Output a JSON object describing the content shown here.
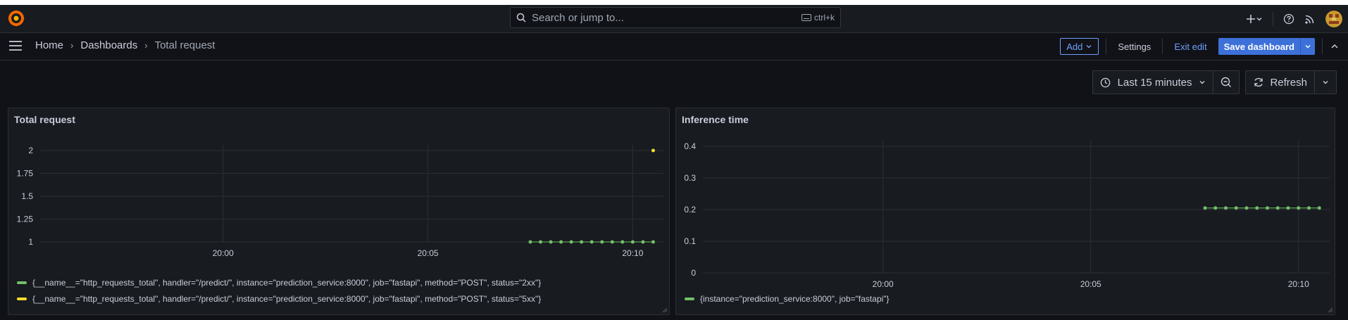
{
  "topbar": {
    "search_placeholder": "Search or jump to...",
    "search_shortcut": "ctrl+k",
    "icons": [
      "grafana-logo",
      "search-icon",
      "keyboard-icon",
      "plus-icon",
      "chevron-down-icon",
      "help-icon",
      "rss-icon",
      "avatar"
    ]
  },
  "navbar": {
    "breadcrumbs": [
      "Home",
      "Dashboards",
      "Total request"
    ],
    "add_label": "Add",
    "settings_label": "Settings",
    "exit_edit_label": "Exit edit",
    "save_label": "Save dashboard"
  },
  "controls": {
    "time_range": "Last 15 minutes",
    "refresh_label": "Refresh"
  },
  "colors": {
    "green": "#73bf69",
    "yellow": "#fade2a",
    "accent": "#6e9fff",
    "primary": "#3d71d9"
  },
  "panels": [
    {
      "title": "Total request",
      "chart_data": {
        "type": "scatter",
        "x_ticks": [
          "20:00",
          "20:05",
          "20:10"
        ],
        "y_ticks": [
          "1",
          "1.25",
          "1.5",
          "1.75",
          "2"
        ],
        "ylim": [
          1,
          2
        ],
        "series": [
          {
            "name": "{__name__=\"http_requests_total\", handler=\"/predict/\", instance=\"prediction_service:8000\", job=\"fastapi\", method=\"POST\", status=\"2xx\"}",
            "color": "#73bf69",
            "points": [
              [
                "20:07:30",
                1
              ],
              [
                "20:07:45",
                1
              ],
              [
                "20:08:00",
                1
              ],
              [
                "20:08:15",
                1
              ],
              [
                "20:08:30",
                1
              ],
              [
                "20:08:45",
                1
              ],
              [
                "20:09:00",
                1
              ],
              [
                "20:09:15",
                1
              ],
              [
                "20:09:30",
                1
              ],
              [
                "20:09:45",
                1
              ],
              [
                "20:10:00",
                1
              ],
              [
                "20:10:15",
                1
              ],
              [
                "20:10:30",
                1
              ]
            ]
          },
          {
            "name": "{__name__=\"http_requests_total\", handler=\"/predict/\", instance=\"prediction_service:8000\", job=\"fastapi\", method=\"POST\", status=\"5xx\"}",
            "color": "#fade2a",
            "points": [
              [
                "20:10:30",
                2
              ]
            ]
          }
        ]
      }
    },
    {
      "title": "Inference time",
      "chart_data": {
        "type": "scatter",
        "x_ticks": [
          "20:00",
          "20:05",
          "20:10"
        ],
        "y_ticks": [
          "0",
          "0.1",
          "0.2",
          "0.3",
          "0.4"
        ],
        "ylim": [
          0,
          0.4
        ],
        "series": [
          {
            "name": "{instance=\"prediction_service:8000\", job=\"fastapi\"}",
            "color": "#73bf69",
            "points": [
              [
                "20:07:45",
                0.205
              ],
              [
                "20:08:00",
                0.205
              ],
              [
                "20:08:15",
                0.205
              ],
              [
                "20:08:30",
                0.205
              ],
              [
                "20:08:45",
                0.205
              ],
              [
                "20:09:00",
                0.205
              ],
              [
                "20:09:15",
                0.205
              ],
              [
                "20:09:30",
                0.205
              ],
              [
                "20:09:45",
                0.205
              ],
              [
                "20:10:00",
                0.205
              ],
              [
                "20:10:15",
                0.205
              ],
              [
                "20:10:30",
                0.205
              ]
            ]
          }
        ]
      }
    }
  ]
}
